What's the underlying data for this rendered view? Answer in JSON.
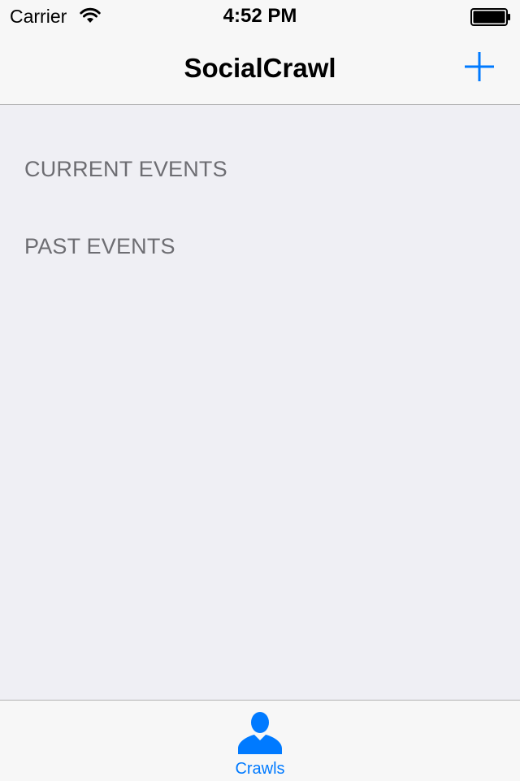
{
  "status_bar": {
    "carrier": "Carrier",
    "time": "4:52 PM",
    "wifi_icon": "wifi-icon",
    "battery_icon": "battery-icon"
  },
  "nav_bar": {
    "title": "SocialCrawl",
    "add_icon": "plus-icon"
  },
  "sections": [
    {
      "header": "CURRENT EVENTS"
    },
    {
      "header": "PAST EVENTS"
    }
  ],
  "tab_bar": {
    "tabs": [
      {
        "label": "Crawls",
        "icon": "person-icon",
        "selected": true
      }
    ]
  },
  "colors": {
    "accent": "#007aff",
    "background": "#efeff4",
    "bar_background": "#f7f7f7",
    "section_header_text": "#6d6d72",
    "separator": "#b2b2b2"
  }
}
